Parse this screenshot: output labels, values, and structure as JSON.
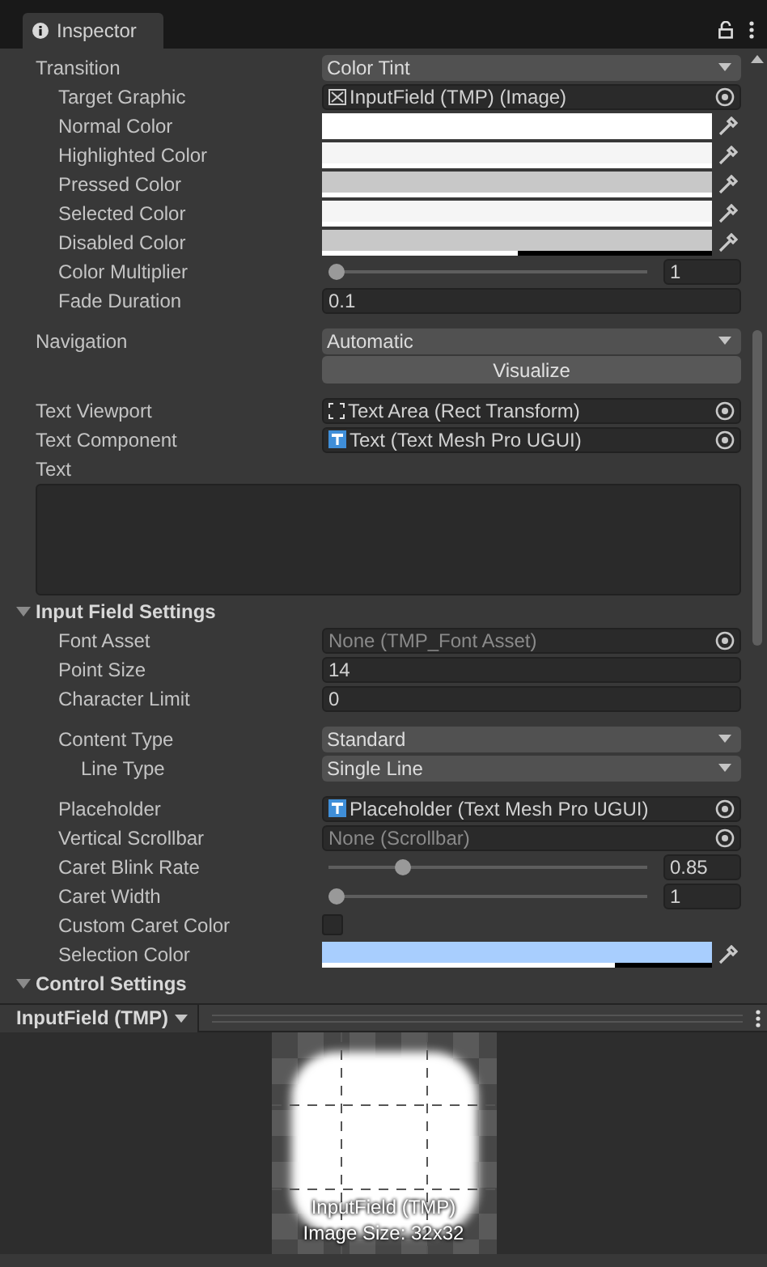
{
  "tab": {
    "title": "Inspector",
    "selected": true
  },
  "groups": [
    {
      "rows": [
        {
          "kind": "dropdown",
          "label": "Transition",
          "value": "Color Tint",
          "children": [
            {
              "kind": "image_object",
              "label": "Target Graphic",
              "value": "InputField (TMP) (Image)"
            },
            {
              "kind": "color",
              "label": "Normal Color",
              "color": "#ffffff",
              "level": 1
            },
            {
              "kind": "color",
              "label": "Highlighted Color",
              "color": "#f5f5f5",
              "level": 1
            },
            {
              "kind": "color",
              "label": "Pressed Color",
              "color": "#c8c8c8",
              "level": 1
            },
            {
              "kind": "color",
              "label": "Selected Color",
              "color": "#f5f5f5",
              "level": 1
            },
            {
              "kind": "color",
              "label": "Disabled Color",
              "color": "#c8c8c8",
              "level": 0.5
            },
            {
              "kind": "slider",
              "label": "Color Multiplier",
              "level": 0,
              "reading": "1"
            },
            {
              "kind": "number",
              "label": "Fade Duration",
              "value": "0.1"
            }
          ]
        }
      ]
    },
    {
      "rows": [
        {
          "kind": "dropdown",
          "label": "Navigation",
          "value": "Automatic"
        },
        {
          "kind": "button",
          "label": "Visualize"
        }
      ]
    },
    {
      "rows": [
        {
          "kind": "rect_object",
          "label": "Text Viewport",
          "value": "Text Area (Rect Transform)"
        },
        {
          "kind": "text_object",
          "label": "Text Component",
          "value": "Text (Text Mesh Pro UGUI)"
        },
        {
          "kind": "textarea",
          "label": "Text"
        }
      ]
    }
  ],
  "foldouts": [
    {
      "label": "Input Field Settings",
      "expanded": true,
      "groups": [
        {
          "rows": [
            {
              "kind": "object",
              "label": "Font Asset",
              "placeholder": "None (TMP_Font Asset)"
            },
            {
              "kind": "number",
              "label": "Point Size",
              "value": "14"
            },
            {
              "kind": "number",
              "label": "Character Limit",
              "value": "0"
            }
          ]
        },
        {
          "rows": [
            {
              "kind": "dropdown",
              "label": "Content Type",
              "value": "Standard",
              "children": [
                {
                  "kind": "dropdown",
                  "label": "Line Type",
                  "value": "Single Line"
                }
              ]
            }
          ]
        },
        {
          "rows": [
            {
              "kind": "text_object",
              "label": "Placeholder",
              "value": "Placeholder (Text Mesh Pro UGUI)"
            },
            {
              "kind": "object",
              "label": "Vertical Scrollbar",
              "placeholder": "None (Scrollbar)"
            },
            {
              "kind": "slider",
              "label": "Caret Blink Rate",
              "level": 0.22,
              "reading": "0.85"
            },
            {
              "kind": "slider",
              "label": "Caret Width",
              "level": 0,
              "reading": "1"
            },
            {
              "kind": "checkbox",
              "label": "Custom Caret Color",
              "checked": false
            },
            {
              "kind": "color",
              "label": "Selection Color",
              "color": "#a8cefe",
              "level": 0.75
            }
          ]
        }
      ]
    },
    {
      "label": "Control Settings",
      "expanded": true
    }
  ],
  "preview": {
    "object": "InputField (TMP)",
    "name": "InputField (TMP)",
    "size": "Image Size: 32x32"
  }
}
